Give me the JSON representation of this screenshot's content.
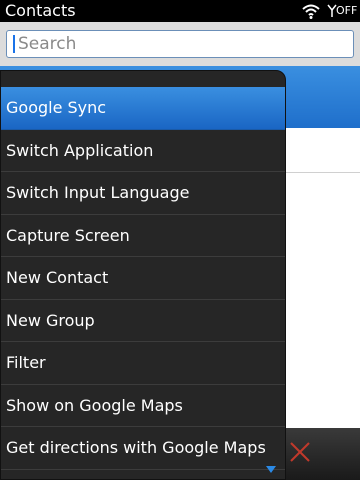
{
  "status_bar": {
    "app_title": "Contacts",
    "wifi_icon": "wifi-icon",
    "radio_icon": "radio-antenna-icon",
    "radio_state": "OFF"
  },
  "search": {
    "placeholder": "Search",
    "value": ""
  },
  "menu": {
    "items": [
      {
        "label": "Google Sync",
        "selected": true
      },
      {
        "label": "Switch Application",
        "selected": false
      },
      {
        "label": "Switch Input Language",
        "selected": false
      },
      {
        "label": "Capture Screen",
        "selected": false
      },
      {
        "label": "New Contact",
        "selected": false
      },
      {
        "label": "New Group",
        "selected": false
      },
      {
        "label": "Filter",
        "selected": false
      },
      {
        "label": "Show on Google Maps",
        "selected": false
      },
      {
        "label": "Get directions with Google Maps",
        "selected": false
      }
    ],
    "scroll_icon": "chevron-down-icon"
  },
  "bottom_bar": {
    "close_icon": "close-icon"
  },
  "colors": {
    "accent_blue": "#2b7fd8",
    "menu_background": "#262626",
    "close_red": "#c0392b"
  }
}
